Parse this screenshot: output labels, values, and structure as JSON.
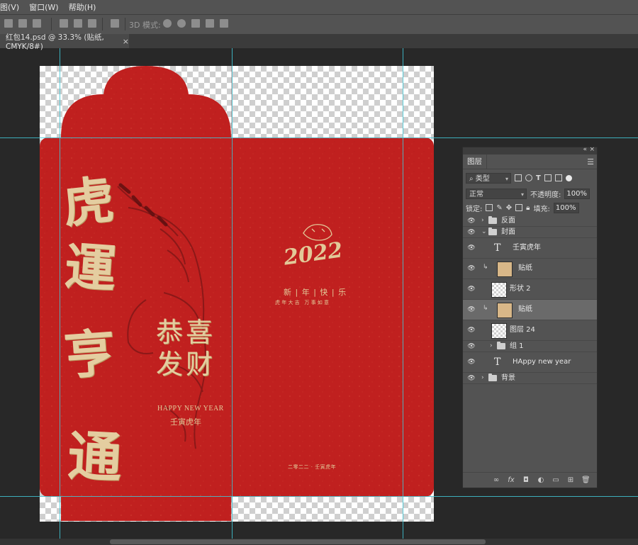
{
  "menu": [
    "图(V)",
    "窗口(W)",
    "帮助(H)"
  ],
  "options": {
    "mode_label": "3D 模式:"
  },
  "tab": {
    "title": "红包14.psd @ 33.3% (贴纸, CMYK/8#)",
    "close": "×"
  },
  "artwork": {
    "left_calligraphy": [
      "虎",
      "運",
      "亨",
      "通"
    ],
    "center_chars": [
      "恭",
      "喜",
      "发",
      "财"
    ],
    "happy_new_year": "HAPPY NEW YEAR",
    "year_name": "壬寅虎年",
    "right_year": "2022",
    "greeting": "新 | 年 | 快 | 乐",
    "greeting_sub": "虎 年 大 吉   万 事 如 意",
    "bottom_text": "二零二二 · 壬寅虎年",
    "red": "#c0201f",
    "gold": "#e2c998"
  },
  "layers_panel": {
    "title": "图层",
    "filter_kind": "类型",
    "blend_mode": "正常",
    "opacity_label": "不透明度:",
    "opacity_value": "100%",
    "lock_label": "锁定:",
    "fill_label": "填充:",
    "fill_value": "100%",
    "layers": [
      {
        "name": "反面",
        "kind": "group",
        "expanded": false
      },
      {
        "name": "封面",
        "kind": "group",
        "expanded": true
      },
      {
        "name": "壬寅虎年",
        "kind": "text"
      },
      {
        "name": "贴纸",
        "kind": "smart",
        "clipped": true
      },
      {
        "name": "形状 2",
        "kind": "shape"
      },
      {
        "name": "贴纸",
        "kind": "smart",
        "clipped": true,
        "active": true
      },
      {
        "name": "图层 24",
        "kind": "pixel"
      },
      {
        "name": "组 1",
        "kind": "group",
        "expanded": false
      },
      {
        "name": "HAppy new year",
        "kind": "text"
      },
      {
        "name": "背景",
        "kind": "group",
        "expanded": false
      }
    ]
  }
}
